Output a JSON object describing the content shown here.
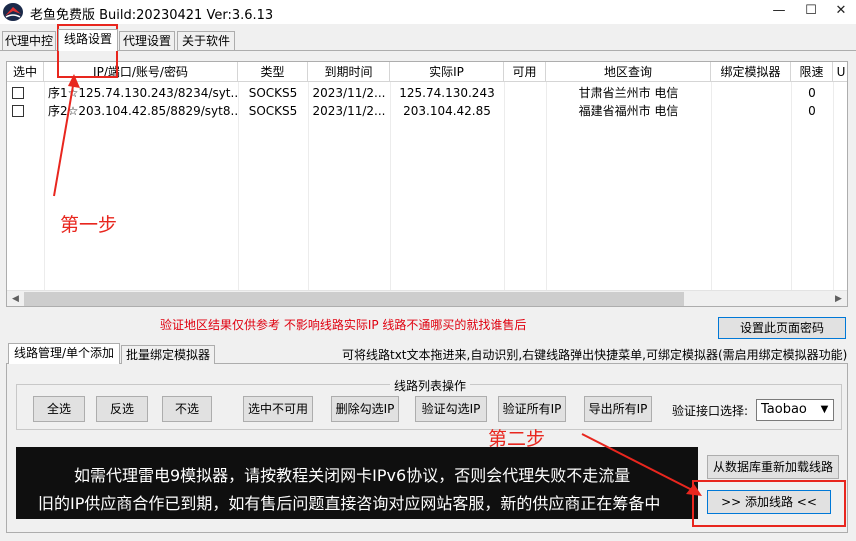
{
  "window": {
    "title": "老鱼免费版 Build:20230421 Ver:3.6.13",
    "minimize": "—",
    "maximize": "☐",
    "close": "✕"
  },
  "main_tabs": [
    {
      "label": "代理中控",
      "active": false
    },
    {
      "label": "线路设置",
      "active": true
    },
    {
      "label": "代理设置",
      "active": false
    },
    {
      "label": "关于软件",
      "active": false
    }
  ],
  "table": {
    "columns": [
      "选中",
      "IP/端口/账号/密码",
      "类型",
      "到期时间",
      "实际IP",
      "可用",
      "地区查询",
      "绑定模拟器",
      "限速",
      "U"
    ],
    "rows": [
      {
        "checked": false,
        "ip": "序1☆125.74.130.243/8234/syt...",
        "type": "SOCKS5",
        "expire": "2023/11/2...",
        "real_ip": "125.74.130.243",
        "available": "",
        "region": "甘肃省兰州市  电信",
        "emulator": "",
        "speed": "0"
      },
      {
        "checked": false,
        "ip": "序2☆203.104.42.85/8829/syt8...",
        "type": "SOCKS5",
        "expire": "2023/11/2...",
        "real_ip": "203.104.42.85",
        "available": "",
        "region": "福建省福州市  电信",
        "emulator": "",
        "speed": "0"
      }
    ]
  },
  "notice": "验证地区结果仅供参考 不影响线路实际IP 线路不通哪买的就找谁售后",
  "set_password_button": "设置此页面密码",
  "sub_tabs": [
    {
      "label": "线路管理/单个添加",
      "active": true
    },
    {
      "label": "批量绑定模拟器",
      "active": false
    }
  ],
  "hint": "可将线路txt文本拖进来,自动识别,右键线路弹出快捷菜单,可绑定模拟器(需启用绑定模拟器功能)",
  "ops": {
    "group_title": "线路列表操作",
    "buttons": [
      "全选",
      "反选",
      "不选",
      "选中不可用",
      "删除勾选IP",
      "验证勾选IP",
      "验证所有IP",
      "导出所有IP"
    ],
    "port_label": "验证接口选择:",
    "port_value": "Taobao"
  },
  "banner": {
    "line1": "如需代理雷电9模拟器，请按教程关闭网卡IPv6协议，否则会代理失败不走流量",
    "line2": "旧的IP供应商合作已到期，如有售后问题直接咨询对应网站客服，新的供应商正在筹备中"
  },
  "reload_button": "从数据库重新加载线路",
  "add_button": ">>  添加线路  <<",
  "annotations": {
    "step1": "第一步",
    "step2": "第二步",
    "color": "#e8261e"
  }
}
